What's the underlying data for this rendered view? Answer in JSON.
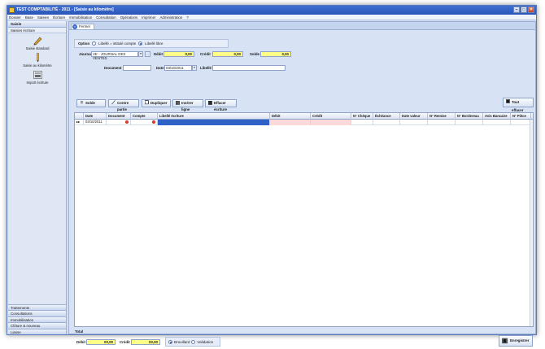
{
  "window": {
    "title": "TEST COMPTABILITÉ - 2011 - [Saisie au kilomètre]"
  },
  "menu": [
    "Dossier",
    "Base",
    "Saisies",
    "Écriture",
    "Immobilisation",
    "Consultation",
    "Opérations",
    "Imprimer",
    "Administration",
    "?"
  ],
  "sidebar": {
    "header": "Saisie",
    "sub": "Saisies écriture",
    "tools": [
      {
        "label": "Saisie standard",
        "icon": "pen-icon"
      },
      {
        "label": "Saisie au kilomètre",
        "icon": "pencil-icon"
      },
      {
        "label": "Import écriture",
        "icon": "import-icon"
      }
    ],
    "bottom": [
      "Traitements",
      "Consultations",
      "Immobilisation",
      "Clôture & nouveau",
      "Liasse"
    ]
  },
  "tab": {
    "label": "Fermer"
  },
  "options": {
    "label": "Option",
    "opt1": "Libellé = intitulé compte",
    "opt2": "Libellé libre"
  },
  "form": {
    "journal_label": "Journal",
    "journal_value": "VE - JOURNAL DES VENTES",
    "debit_label": "Débit",
    "debit_value": "0,00",
    "credit_label": "Crédit",
    "credit_value": "0,00",
    "solde_label": "Solde",
    "solde_value": "0,00",
    "document_label": "Document",
    "date_label": "Date",
    "date_value": "03/10/2011",
    "libelle_label": "Libellé"
  },
  "buttons": {
    "solde": "Solde",
    "contrepartie": "Contre partie",
    "dupliquer": "Dupliquer",
    "inserer": "Insérer ligne",
    "effacer": "Effacer écriture",
    "tout_effacer": "Tout effacer"
  },
  "grid": {
    "headers": [
      "Date",
      "Document",
      "Compte",
      "Libellé écriture",
      "Débit",
      "Crédit",
      "N° Chèque",
      "Échéance",
      "Date valeur",
      "N° Remise",
      "N° Bordereau",
      "Avis Bancaire",
      "N° Pièce"
    ],
    "row": {
      "marker": "▸▸",
      "date": "03/10/2011"
    }
  },
  "footer": {
    "total_label": "Total",
    "debit_label": "Débit",
    "debit_value": "00,00",
    "credit_label": "Crédit",
    "credit_value": "00,00",
    "brouillard": "Brouillard",
    "validation": "Validation",
    "save": "Enregistrer"
  },
  "colors": {
    "title": "#2a55b8",
    "yellow": "#ffff88",
    "selected": "#2f62c9",
    "error": "#d32a1e"
  }
}
